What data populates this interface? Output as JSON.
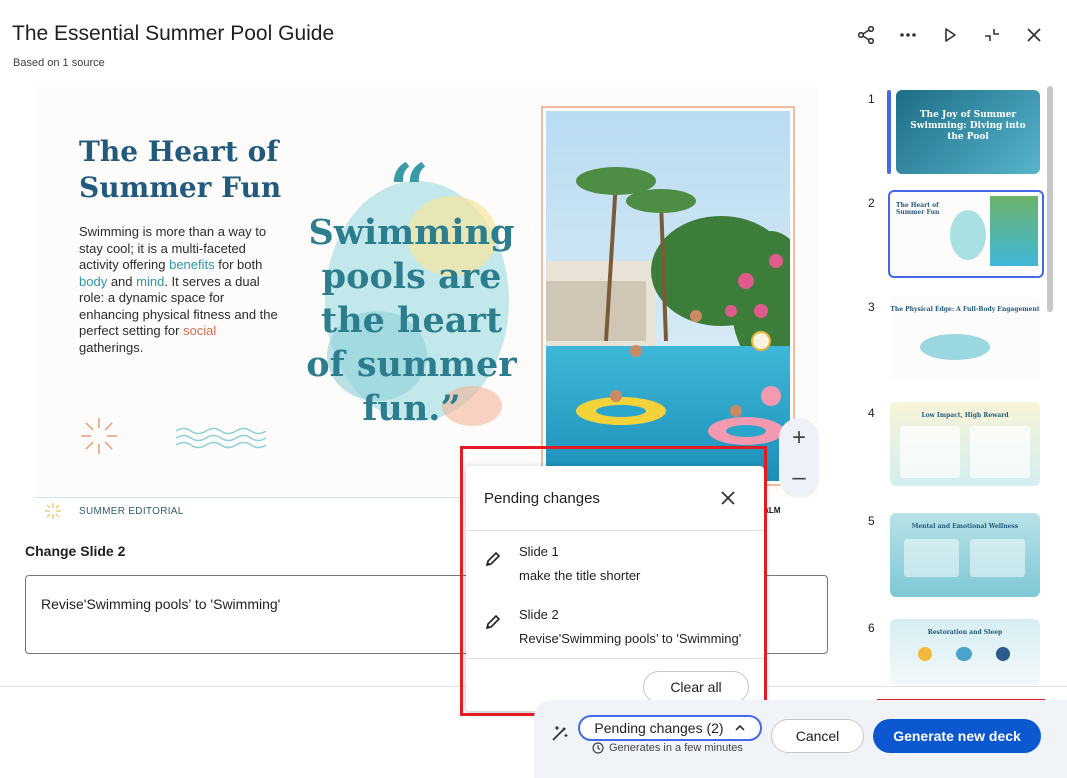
{
  "header": {
    "title": "The Essential Summer Pool Guide",
    "subtitle": "Based on 1 source"
  },
  "header_icons": [
    "share-icon",
    "more-icon",
    "play-icon",
    "collapse-icon",
    "close-icon"
  ],
  "slide": {
    "heading": "The Heart of Summer Fun",
    "body_parts": [
      "Swimming is more than a way to stay cool; it is a multi-faceted activity offering ",
      "benefits",
      " for both ",
      "body",
      " and ",
      "mind",
      ". It serves a dual role: a dynamic space for enhancing physical fitness and the perfect setting for ",
      "social",
      " gatherings."
    ],
    "quote": "Swimming pools are the heart of summer fun.”",
    "quote_mark": "“",
    "footer_label": "SUMMER EDITORIAL",
    "watermark": "NotebookLM"
  },
  "zoom": {
    "plus": "+",
    "minus": "–"
  },
  "change": {
    "label": "Change Slide 2",
    "value": "Revise'Swimming pools’ to 'Swimming'"
  },
  "thumbnails": [
    {
      "num": "1",
      "title": "The Joy of Summer Swimming: Diving into the Pool"
    },
    {
      "num": "2",
      "title": "The Heart of Summer Fun"
    },
    {
      "num": "3",
      "title": "The Physical Edge: A Full-Body Engagement"
    },
    {
      "num": "4",
      "title": "Low Impact, High Reward"
    },
    {
      "num": "5",
      "title": "Mental and Emotional Wellness"
    },
    {
      "num": "6",
      "title": "Restoration and Sleep"
    }
  ],
  "popup": {
    "title": "Pending changes",
    "items": [
      {
        "slide": "Slide 1",
        "text": "make the title shorter"
      },
      {
        "slide": "Slide 2",
        "text": "Revise'Swimming pools’ to 'Swimming'"
      }
    ],
    "clear_label": "Clear all"
  },
  "bottom": {
    "pending_label": "Pending changes (2)",
    "note": "Generates in a few minutes",
    "cancel_label": "Cancel",
    "generate_label": "Generate new deck"
  },
  "colors": {
    "primary": "#0b57d0",
    "highlight": "#e31c23",
    "heading": "#215a7c",
    "quote": "#2c7d8e"
  }
}
